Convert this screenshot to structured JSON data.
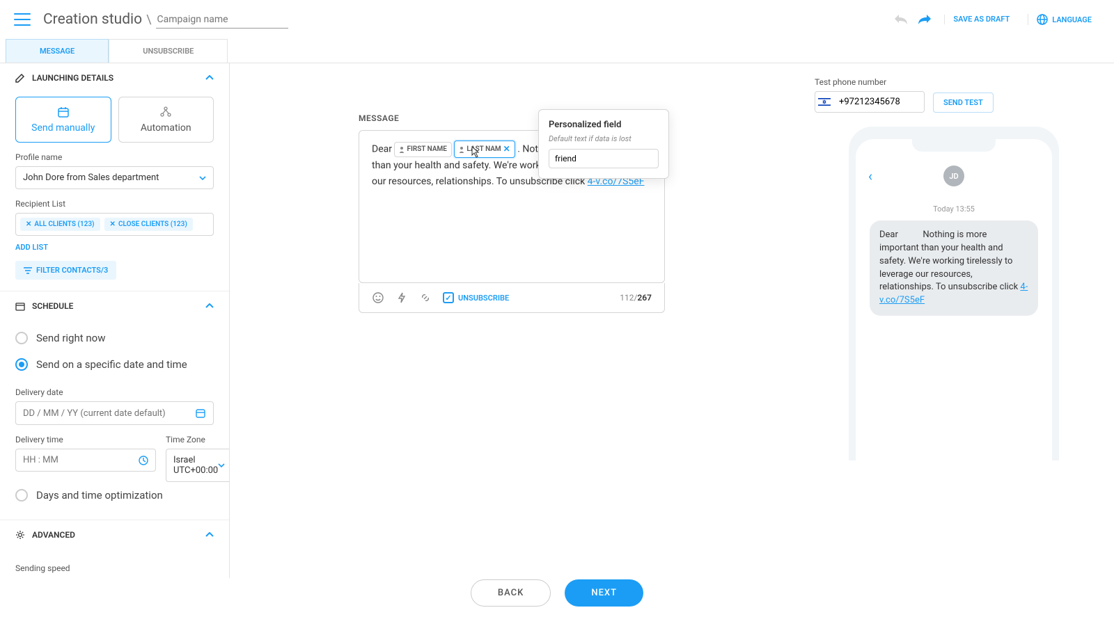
{
  "header": {
    "title": "Creation studio",
    "campaign_placeholder": "Campaign name",
    "save_draft": "SAVE AS DRAFT",
    "language": "LANGUAGE"
  },
  "tabs": {
    "message": "MESSAGE",
    "unsubscribe": "UNSUBSCRIBE"
  },
  "launching": {
    "title": "LAUNCHING DETAILS",
    "send_manually": "Send manually",
    "automation": "Automation",
    "profile_label": "Profile name",
    "profile_value": "John Dore from Sales department",
    "recipient_label": "Recipient List",
    "chips": [
      "ALL CLIENTS (123)",
      "CLOSE CLIENTS (123)"
    ],
    "add_list": "ADD LIST",
    "filter": "FILTER CONTACTS/3"
  },
  "schedule": {
    "title": "SCHEDULE",
    "opt_now": "Send right now",
    "opt_specific": "Send on a specific date and time",
    "delivery_date_label": "Delivery date",
    "delivery_date_placeholder": "DD / MM / YY (current date default)",
    "delivery_time_label": "Delivery time",
    "delivery_time_placeholder": "HH : MM",
    "tz_label": "Time Zone",
    "tz_value": "Israel UTC+00:00",
    "opt_days": "Days and time optimization"
  },
  "advanced": {
    "title": "ADVANCED",
    "speed_label": "Sending speed"
  },
  "editor": {
    "label": "MESSAGE",
    "dear": "Dear",
    "tag_first": "FIRST NAME",
    "tag_last": "LAST NAM",
    "body_after": ". Nothing is more important than your health and safety. We're working tirelessly to leverage our resources, relationships. To unsubscribe click ",
    "unsub_url": "4-v.co/7S5eF",
    "unsub_label": "UNSUBSCRIBE",
    "count_used": "112",
    "count_total": "267"
  },
  "popover": {
    "title": "Personalized field",
    "sub": "Default text if data is lost",
    "value": "friend"
  },
  "preview": {
    "test_label": "Test phone number",
    "phone": "+97212345678",
    "send_test": "SEND TEST",
    "avatar": "JD",
    "date": "Today 13:55",
    "bubble_pre": "Dear ",
    "bubble_body": "Nothing is more important than your health and safety. We're working tirelessly to leverage our resources, relationships. To unsubscribe click ",
    "bubble_link": "4-v.co/7S5eF"
  },
  "footer": {
    "back": "BACK",
    "next": "NEXT"
  }
}
